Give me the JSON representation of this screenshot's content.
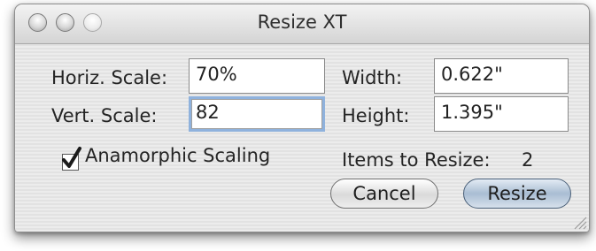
{
  "window": {
    "title": "Resize XT"
  },
  "form": {
    "horiz_scale_label": "Horiz. Scale:",
    "horiz_scale_value": "70%",
    "vert_scale_label": "Vert. Scale:",
    "vert_scale_value": "82",
    "width_label": "Width:",
    "width_value": "0.622\"",
    "height_label": "Height:",
    "height_value": "1.395\"",
    "anamorphic_label": "Anamorphic Scaling",
    "anamorphic_checked": true,
    "items_label": "Items to Resize:",
    "items_count": "2"
  },
  "buttons": {
    "cancel": "Cancel",
    "resize": "Resize"
  },
  "icons": {
    "close": "close-icon",
    "minimize": "minimize-icon",
    "zoom": "zoom-icon",
    "checkmark": "checkmark-icon",
    "resize_grip": "resize-grip-icon"
  }
}
